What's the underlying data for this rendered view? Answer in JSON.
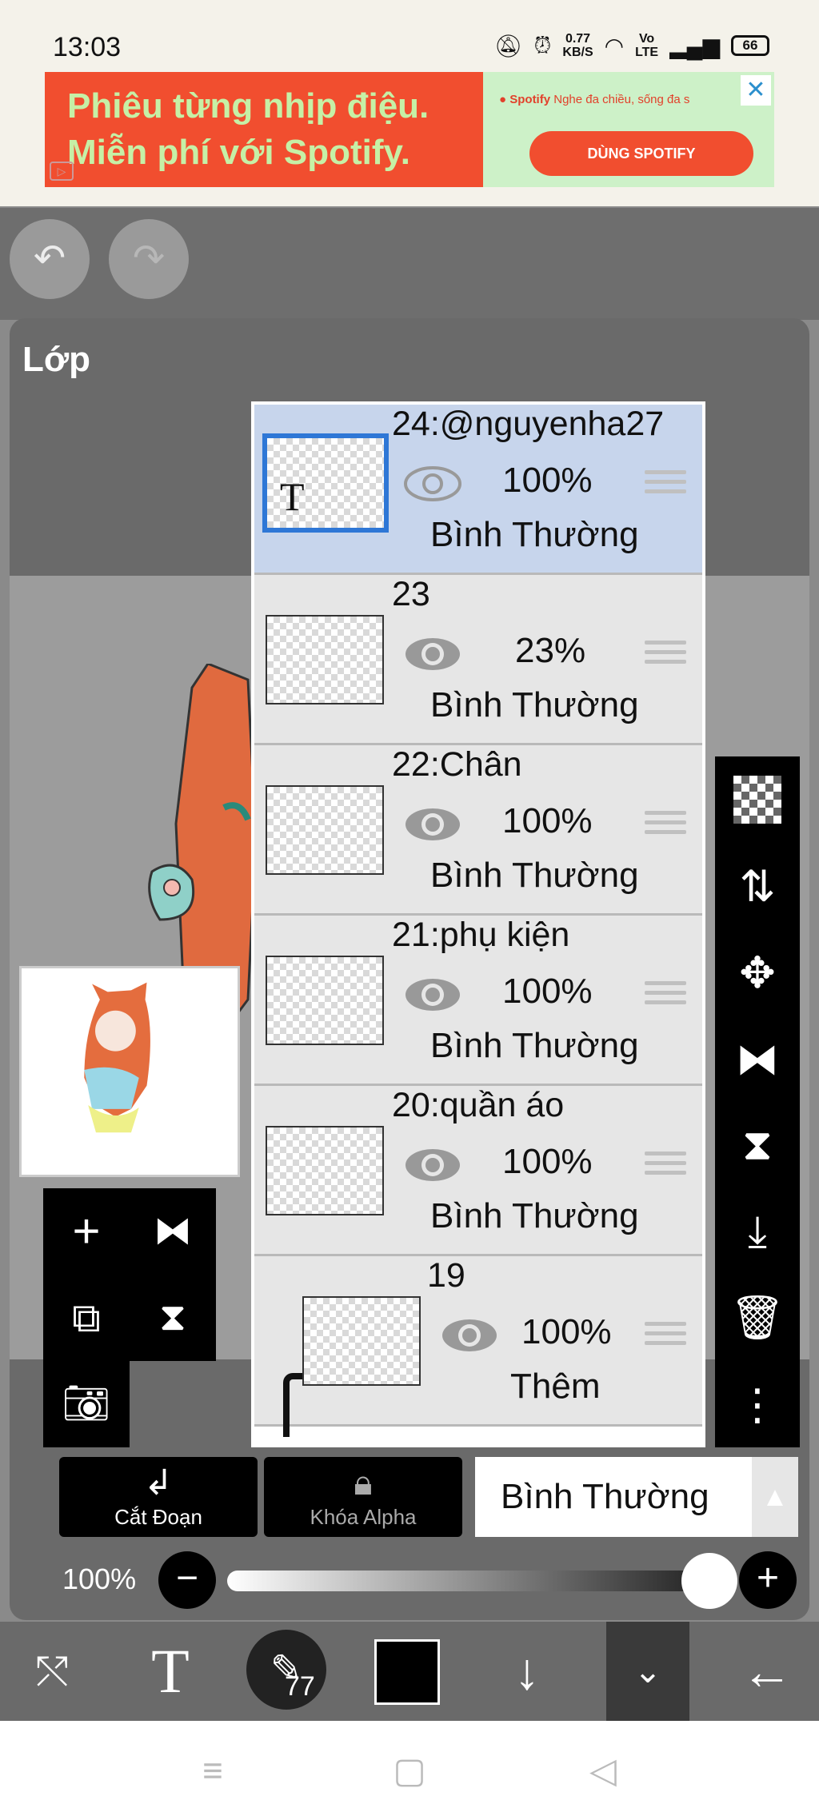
{
  "status_bar": {
    "time": "13:03",
    "net_speed_value": "0.77",
    "net_speed_unit": "KB/S",
    "volte_top": "Vo",
    "volte_bottom": "LTE",
    "battery": "66"
  },
  "ad": {
    "headline_line1": "Phiêu từng nhịp điệu.",
    "headline_line2": "Miễn phí với Spotify.",
    "brand": "Spotify",
    "tagline": "Nghe đa chiều, sống đa s",
    "cta": "DÙNG SPOTIFY",
    "close": "✕"
  },
  "toolbar_top": {
    "undo_icon": "↶",
    "redo_icon": "↷"
  },
  "layers_panel": {
    "title": "Lớp",
    "layers": [
      {
        "name": "24:@nguyenha27",
        "opacity": "100%",
        "blend": "Bình Thường"
      },
      {
        "name": "23",
        "opacity": "23%",
        "blend": "Bình Thường"
      },
      {
        "name": "22:Chân",
        "opacity": "100%",
        "blend": "Bình Thường"
      },
      {
        "name": "21:phụ kiện",
        "opacity": "100%",
        "blend": "Bình Thường"
      },
      {
        "name": "20:quần áo",
        "opacity": "100%",
        "blend": "Bình Thường"
      },
      {
        "name": "19",
        "opacity": "100%",
        "blend": "Thêm"
      }
    ],
    "thumb_text": "T"
  },
  "controls": {
    "clip_label": "Cắt Đoạn",
    "alpha_lock_label": "Khóa Alpha",
    "blend_mode": "Bình Thường",
    "opacity_label": "100%",
    "opacity_value": 1.0,
    "minus": "−",
    "plus": "+"
  },
  "bottom_toolbar": {
    "text_tool": "T",
    "pen_size": "77"
  },
  "colors": {
    "selected_layer_bg": "#c7d5ec",
    "selected_border": "#2e77d6",
    "ad_red": "#f14e2f",
    "ad_green": "#cdf1c8",
    "primary_color": "#000000"
  }
}
